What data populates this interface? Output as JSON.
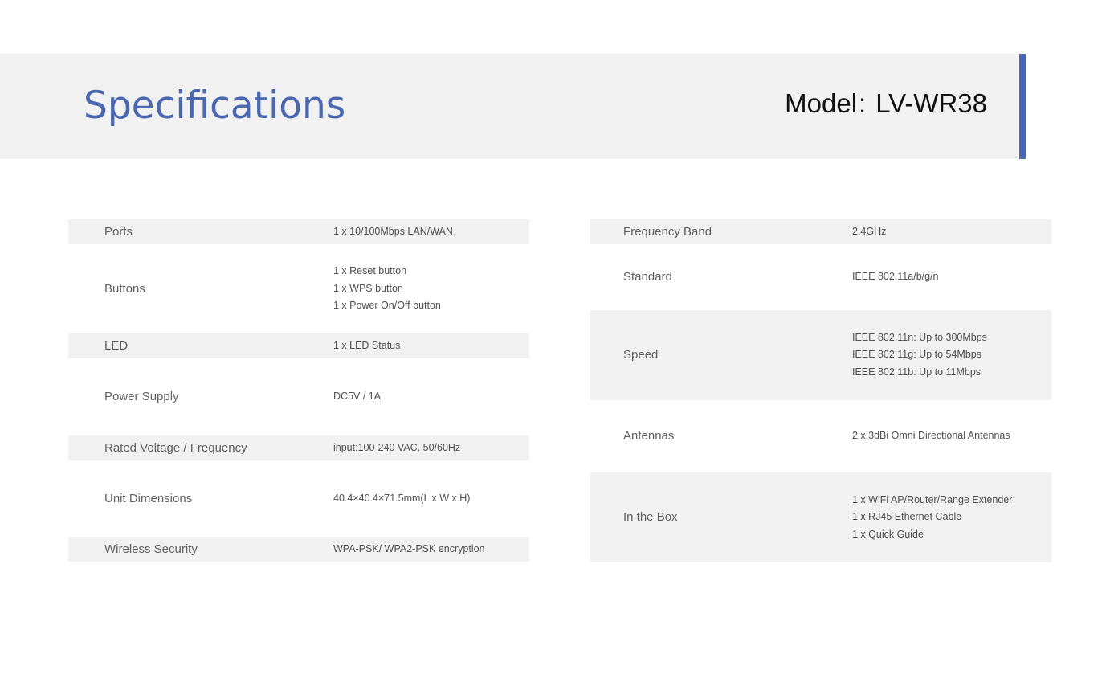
{
  "header": {
    "title": "Specifications",
    "model_label": "Model",
    "model_sep": ":",
    "model_value": "LV-WR38"
  },
  "left_specs": [
    {
      "label": "Ports",
      "values": [
        "1 x 10/100Mbps LAN/WAN"
      ]
    },
    {
      "label": "Buttons",
      "values": [
        "1 x Reset button",
        "1 x WPS button",
        "1 x Power On/Off button"
      ]
    },
    {
      "label": "LED",
      "values": [
        "1 x LED Status"
      ]
    },
    {
      "label": "Power Supply",
      "values": [
        "DC5V / 1A"
      ]
    },
    {
      "label": "Rated Voltage / Frequency",
      "values": [
        "input:100-240 VAC. 50/60Hz"
      ]
    },
    {
      "label": "Unit Dimensions",
      "values": [
        "40.4×40.4×71.5mm(L x W x H)"
      ]
    },
    {
      "label": "Wireless Security",
      "values": [
        "WPA-PSK/ WPA2-PSK encryption"
      ]
    }
  ],
  "right_specs": [
    {
      "label": "Frequency Band",
      "values": [
        "2.4GHz"
      ]
    },
    {
      "label": "Standard",
      "values": [
        "IEEE 802.11a/b/g/n"
      ]
    },
    {
      "label": "Speed",
      "values": [
        "IEEE 802.11n: Up to 300Mbps",
        "IEEE 802.11g: Up to 54Mbps",
        "IEEE 802.11b: Up to 11Mbps"
      ]
    },
    {
      "label": "Antennas",
      "values": [
        "2 x 3dBi Omni Directional Antennas"
      ]
    },
    {
      "label": "In the Box",
      "values": [
        "1 x WiFi AP/Router/Range Extender",
        "1 x RJ45 Ethernet Cable",
        "1 x Quick Guide"
      ]
    }
  ],
  "colors": {
    "accent": "#4a67b0",
    "shade": "#f1f1f1",
    "text": "#5a5a5a"
  }
}
